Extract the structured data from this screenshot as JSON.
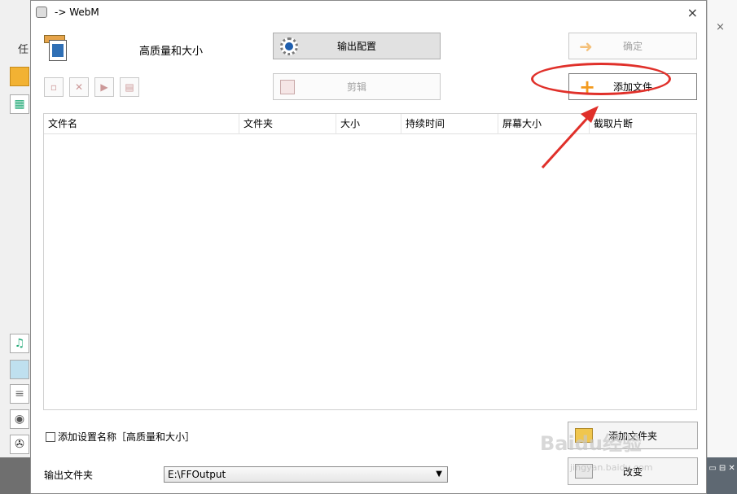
{
  "background_app": {
    "left_label": "任",
    "icons": [
      "folder-icon",
      "clapper-icon",
      "music-icon",
      "picture-icon",
      "document-icon",
      "disc-icon",
      "film-reel-icon"
    ]
  },
  "dialog": {
    "title": "-> WebM",
    "close_label": "×",
    "profile_name": "高质量和大小",
    "output_config_label": "输出配置",
    "ok_label": "确定",
    "edit_label": "剪辑",
    "add_file_label": "添加文件",
    "file_list": {
      "columns": [
        "文件名",
        "文件夹",
        "大小",
        "持续时间",
        "屏幕大小",
        "截取片断"
      ],
      "rows": []
    },
    "add_setting_name_label": "添加设置名称［高质量和大小］",
    "add_setting_name_checked": false,
    "add_folder_label": "添加文件夹",
    "browse_label": "改变",
    "output_folder_label": "输出文件夹",
    "output_folder_value": "E:\\FFOutput"
  },
  "annotation": {
    "color": "#e0302a"
  },
  "watermark": {
    "text": "Baidu经验",
    "url": "jingyan.baidu.com"
  }
}
